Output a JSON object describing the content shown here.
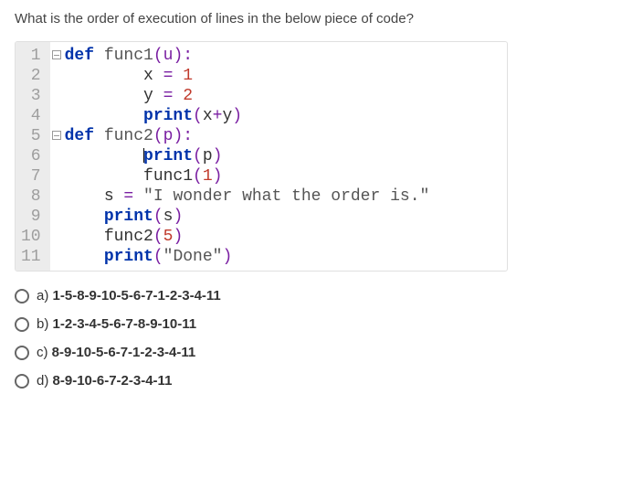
{
  "question": "What is the order of execution of lines in the below piece of code?",
  "code": {
    "lines": [
      {
        "n": "1",
        "html": "<span class='kw'>def</span> <span class='fn'>func1</span><span class='op'>(u)</span><span class='op'>:</span>",
        "fold": true,
        "indent": 0
      },
      {
        "n": "2",
        "html": "x <span class='op'>=</span> <span class='num'>1</span>",
        "fold": false,
        "indent": 2
      },
      {
        "n": "3",
        "html": "y <span class='op'>=</span> <span class='num'>2</span>",
        "fold": false,
        "indent": 2
      },
      {
        "n": "4",
        "html": "<span class='kw'>print</span><span class='op'>(</span>x<span class='op'>+</span>y<span class='op'>)</span>",
        "fold": false,
        "indent": 2,
        "closeFold": true
      },
      {
        "n": "5",
        "html": "<span class='kw'>def</span> <span class='fn'>func2</span><span class='op'>(p)</span><span class='op'>:</span>",
        "fold": true,
        "indent": 0
      },
      {
        "n": "6",
        "html": "<span class='kw'>print</span><span class='op'>(</span>p<span class='op'>)</span>",
        "fold": false,
        "indent": 2,
        "caret": true
      },
      {
        "n": "7",
        "html": "func1<span class='op'>(</span><span class='num'>1</span><span class='op'>)</span>",
        "fold": false,
        "indent": 2,
        "closeFold": true
      },
      {
        "n": "8",
        "html": "s <span class='op'>=</span> <span class='str'>\"I wonder what the order is.\"</span>",
        "fold": false,
        "indent": 1
      },
      {
        "n": "9",
        "html": "<span class='kw'>print</span><span class='op'>(</span>s<span class='op'>)</span>",
        "fold": false,
        "indent": 1
      },
      {
        "n": "10",
        "html": "func2<span class='op'>(</span><span class='num'>5</span><span class='op'>)</span>",
        "fold": false,
        "indent": 1
      },
      {
        "n": "11",
        "html": "<span class='kw'>print</span><span class='op'>(</span><span class='str'>\"Done\"</span><span class='op'>)</span>",
        "fold": false,
        "indent": 1
      }
    ]
  },
  "options": [
    {
      "letter": "a)",
      "text": "1-5-8-9-10-5-6-7-1-2-3-4-11"
    },
    {
      "letter": "b)",
      "text": "1-2-3-4-5-6-7-8-9-10-11"
    },
    {
      "letter": "c)",
      "text": "8-9-10-5-6-7-1-2-3-4-11"
    },
    {
      "letter": "d)",
      "text": "8-9-10-6-7-2-3-4-11"
    }
  ]
}
